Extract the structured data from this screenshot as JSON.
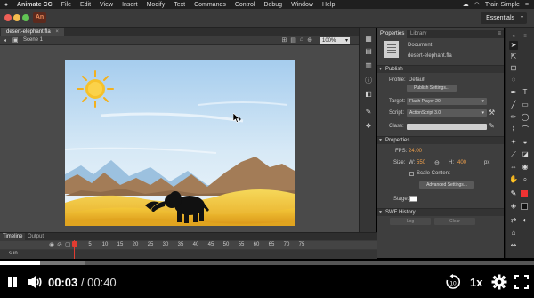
{
  "menubar": {
    "app_name": "Animate CC",
    "items": [
      "File",
      "Edit",
      "View",
      "Insert",
      "Modify",
      "Text",
      "Commands",
      "Control",
      "Debug",
      "Window",
      "Help"
    ],
    "right_label": "Train Simple"
  },
  "appbar": {
    "app_badge": "An",
    "workspace": "Essentials"
  },
  "document": {
    "tab_title": "desert-elephant.fla",
    "scene_label": "Scene 1",
    "zoom": "100%"
  },
  "properties": {
    "tabs": [
      "Properties",
      "Library"
    ],
    "doc_type": "Document",
    "file_name": "desert-elephant.fla",
    "publish_header": "Publish",
    "profile_label": "Profile:",
    "profile_value": "Default",
    "publish_settings_button": "Publish Settings...",
    "target_label": "Target:",
    "target_value": "Flash Player 20",
    "script_label": "Script:",
    "script_value": "ActionScript 3.0",
    "class_label": "Class:",
    "properties_header": "Properties",
    "fps_label": "FPS:",
    "fps_value": "24.00",
    "size_label": "Size:",
    "w_label": "W:",
    "w_value": "550",
    "h_label": "H:",
    "h_value": "400",
    "unit": "px",
    "scale_content": "Scale Content",
    "advanced_settings_button": "Advanced Settings...",
    "stage_label": "Stage:",
    "swf_history_header": "SWF History",
    "log_button": "Log",
    "clear_button": "Clear"
  },
  "timeline": {
    "tabs": [
      "Timeline",
      "Output"
    ],
    "frame_numbers": [
      "1",
      "5",
      "10",
      "15",
      "20",
      "25",
      "30",
      "35",
      "40",
      "45",
      "50",
      "55",
      "60",
      "65",
      "70",
      "75"
    ],
    "layer_name": "sun"
  },
  "player": {
    "current_time": "00:03",
    "separator": "/",
    "duration": "00:40",
    "speed": "1x",
    "progress_fraction": 0.075,
    "buffer_fraction": 0.16
  },
  "colors": {
    "accent_orange": "#f0a04b",
    "playhead_red": "#e03c31",
    "sky_top": "#a6cdee",
    "sand": "#f2c23c"
  }
}
